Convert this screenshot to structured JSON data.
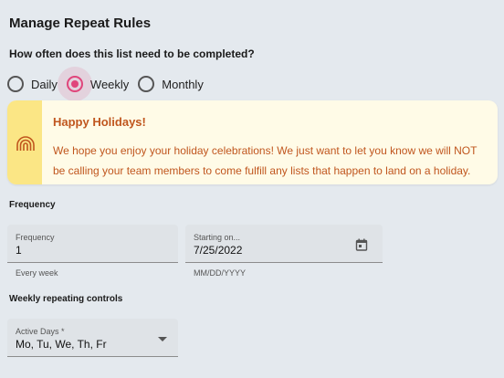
{
  "page": {
    "title": "Manage Repeat Rules",
    "question": "How often does this list need to be completed?"
  },
  "repeat_options": {
    "selected": "Weekly",
    "options": [
      "Daily",
      "Weekly",
      "Monthly"
    ]
  },
  "banner": {
    "icon": "rainbow-icon",
    "title": "Happy Holidays!",
    "message": "We hope you enjoy your holiday celebrations! We just want to let you know we will NOT be calling your team members to come fulfill any lists that happen to land on a holiday. Cheers!",
    "colors": {
      "background": "#fffbe7",
      "stripe": "#fbe685",
      "text": "#c0561e"
    }
  },
  "frequency_section": {
    "heading": "Frequency",
    "frequency_field": {
      "label": "Frequency",
      "value": "1",
      "helper": "Every week"
    },
    "start_field": {
      "label": "Starting on...",
      "value": "7/25/2022",
      "helper": "MM/DD/YYYY",
      "icon": "calendar-icon"
    }
  },
  "weekly_section": {
    "heading": "Weekly repeating controls",
    "active_days_field": {
      "label": "Active Days *",
      "value": "Mo, Tu, We, Th, Fr",
      "icon": "chevron-down-icon"
    }
  },
  "colors": {
    "accent": "#e0457b",
    "page_background": "#e4e9ee"
  }
}
